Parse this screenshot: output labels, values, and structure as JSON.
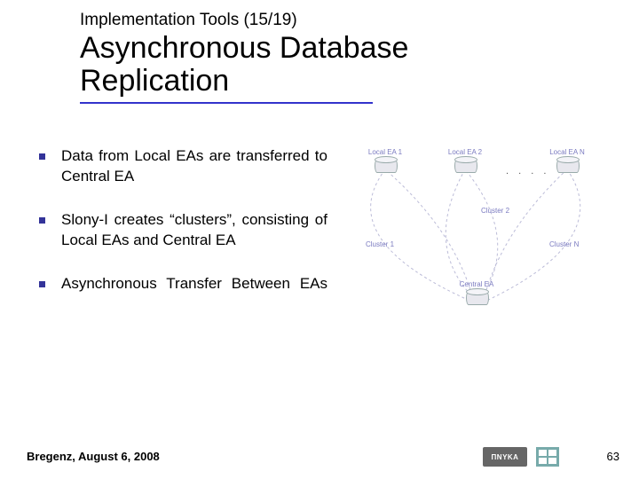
{
  "header": {
    "supertitle": "Implementation Tools (15/19)",
    "title_l1": "Asynchronous Database",
    "title_l2": "Replication"
  },
  "bullets": {
    "b1": "Data from Local EAs are transferred to Central EA",
    "b2": "Slony-I creates “clusters”, consisting of Local EAs and Central EA",
    "b3": "Asynchronous Transfer Between EAs"
  },
  "diagram": {
    "n1": "Local EA 1",
    "n2": "Local EA 2",
    "n3": "Local EA N",
    "center": "Central EA",
    "c1": "Cluster 1",
    "c2": "Cluster 2",
    "cN": "Cluster N",
    "dots": ". . . ."
  },
  "footer": {
    "location_date": "Bregenz, August 6, 2008",
    "page": "63",
    "logo_a": "ΠNYKA"
  }
}
